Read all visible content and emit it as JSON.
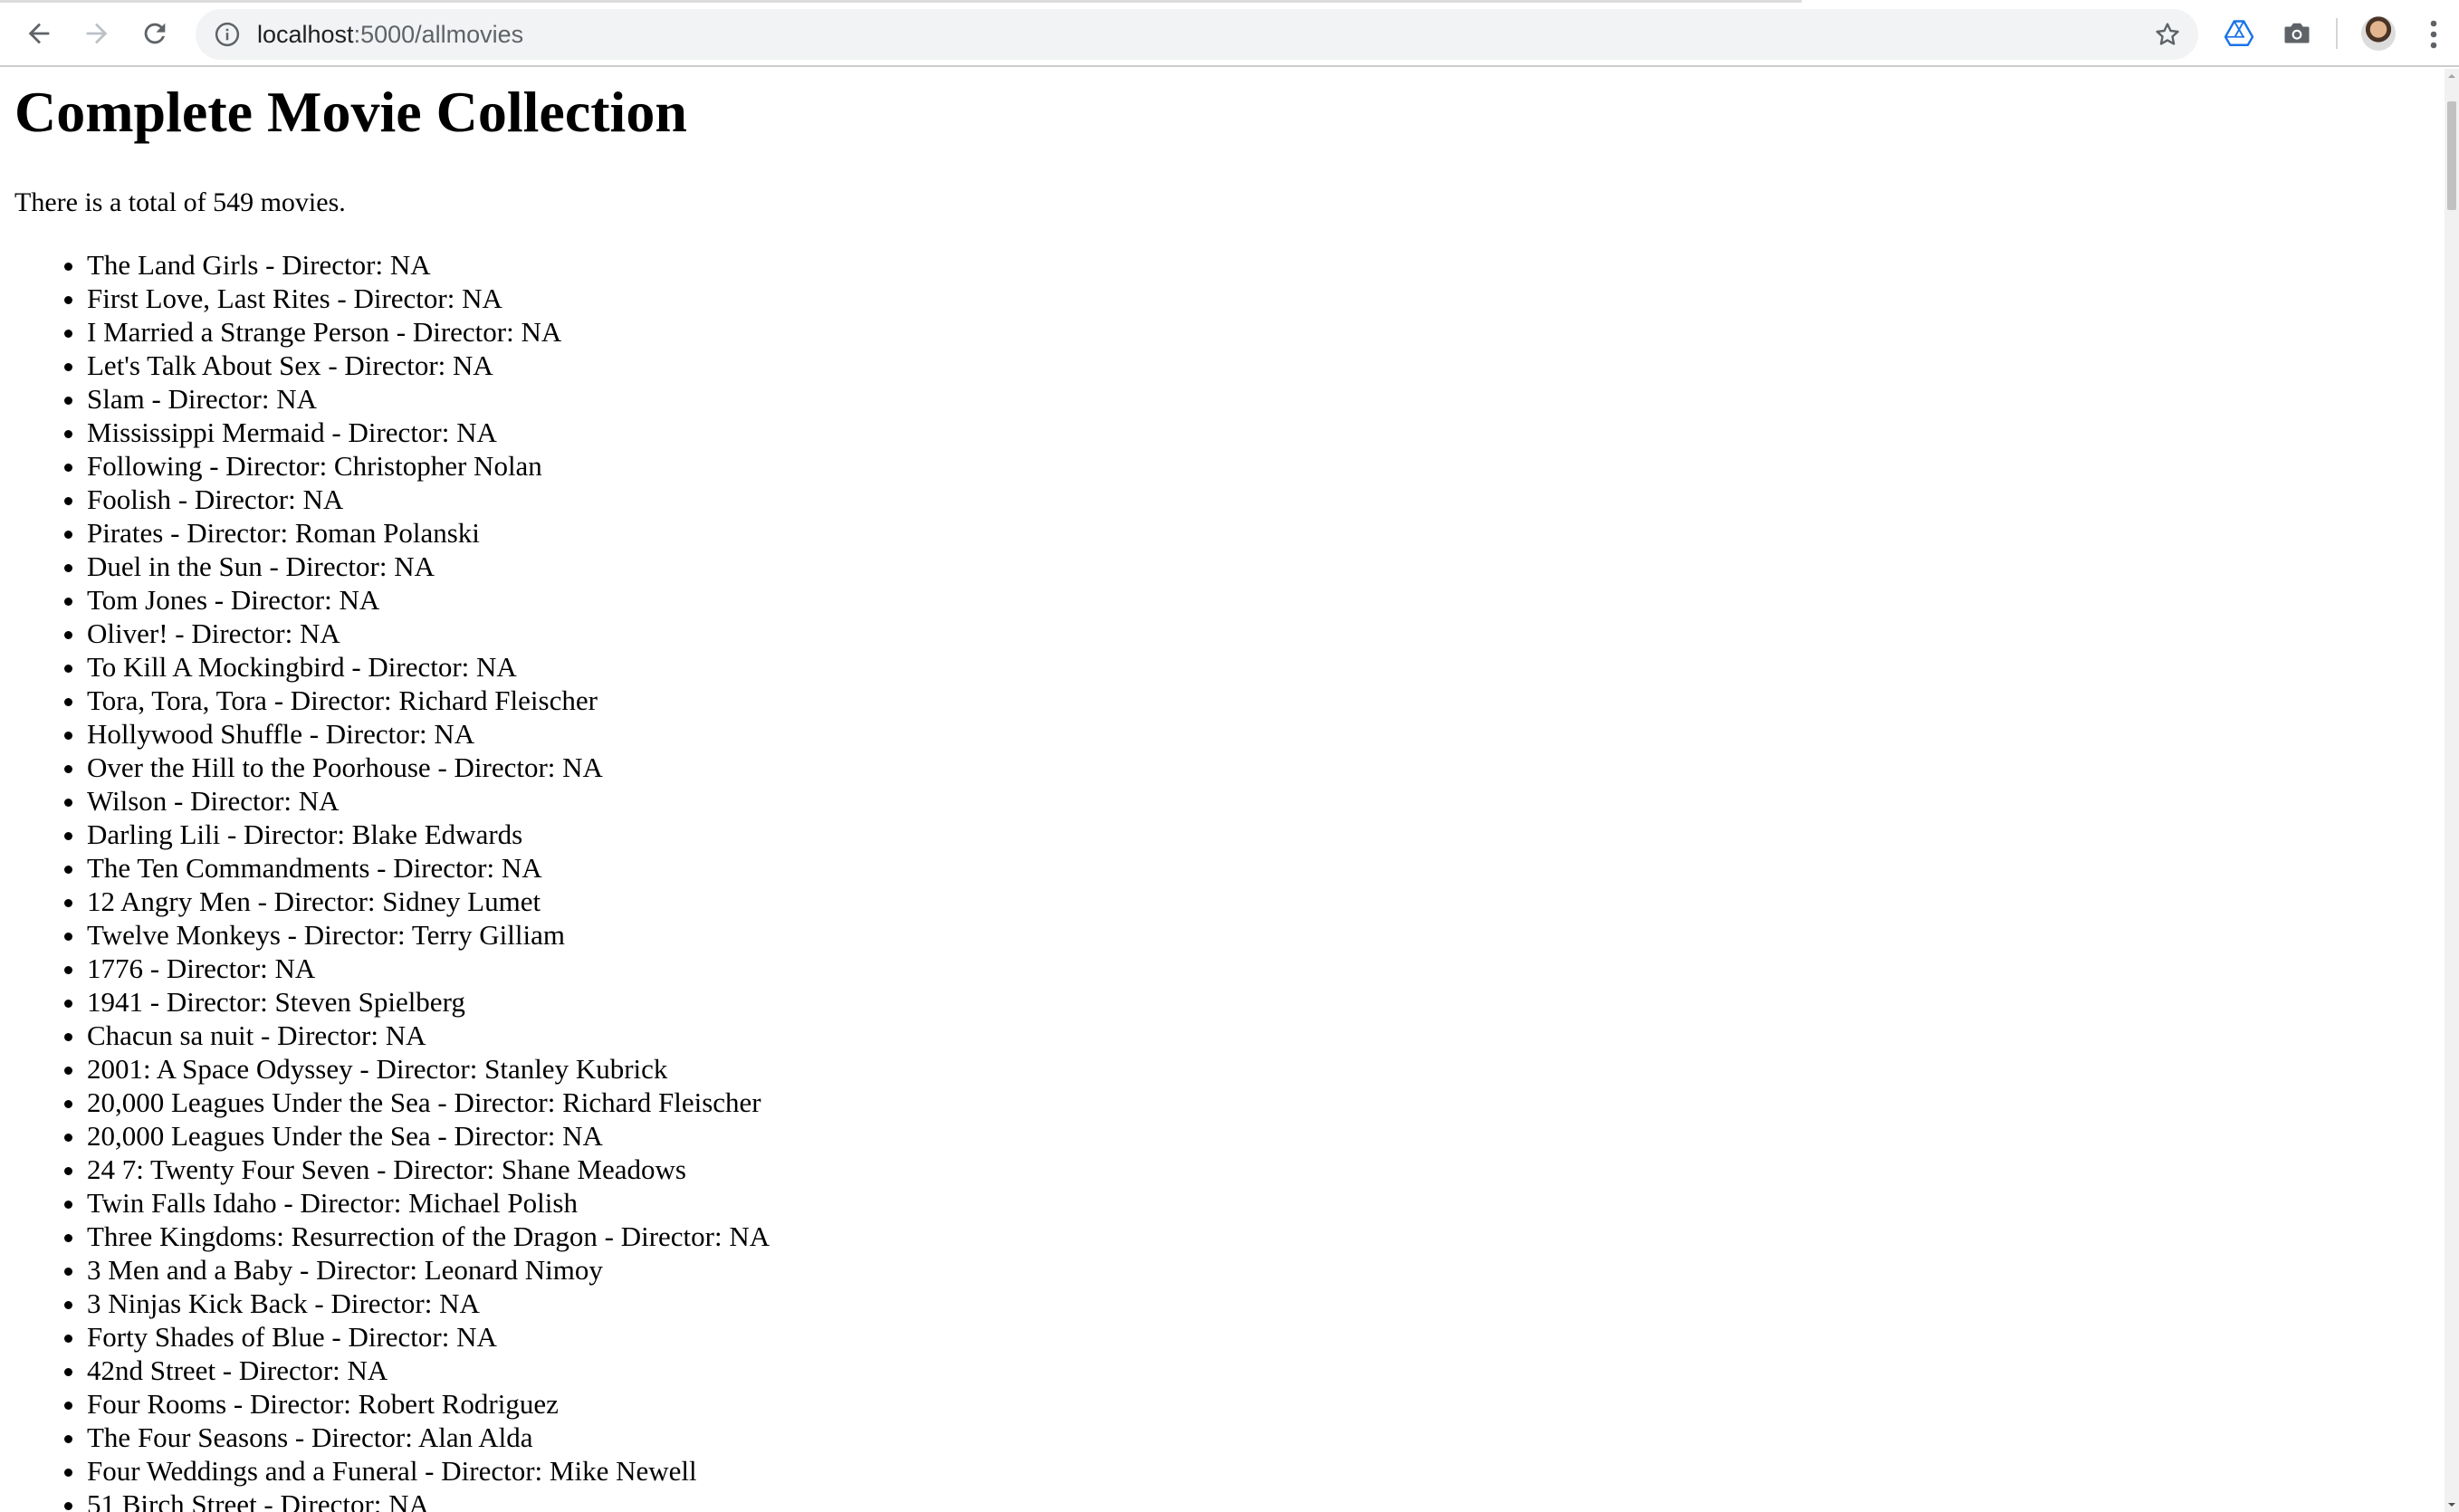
{
  "browser": {
    "url_host": "localhost",
    "url_path": ":5000/allmovies",
    "icons": {
      "back": "arrow-left-icon",
      "forward": "arrow-right-icon",
      "reload": "reload-icon",
      "site_info": "info-icon",
      "bookmark": "star-icon",
      "extension": "drive-icon",
      "screenshot": "camera-icon",
      "profile": "avatar",
      "menu": "kebab-menu-icon"
    }
  },
  "page": {
    "title": "Complete Movie Collection",
    "total_text": "There is a total of 549 movies.",
    "movies": [
      "The Land Girls - Director: NA",
      "First Love, Last Rites - Director: NA",
      "I Married a Strange Person - Director: NA",
      "Let's Talk About Sex - Director: NA",
      "Slam - Director: NA",
      "Mississippi Mermaid - Director: NA",
      "Following - Director: Christopher Nolan",
      "Foolish - Director: NA",
      "Pirates - Director: Roman Polanski",
      "Duel in the Sun - Director: NA",
      "Tom Jones - Director: NA",
      "Oliver! - Director: NA",
      "To Kill A Mockingbird - Director: NA",
      "Tora, Tora, Tora - Director: Richard Fleischer",
      "Hollywood Shuffle - Director: NA",
      "Over the Hill to the Poorhouse - Director: NA",
      "Wilson - Director: NA",
      "Darling Lili - Director: Blake Edwards",
      "The Ten Commandments - Director: NA",
      "12 Angry Men - Director: Sidney Lumet",
      "Twelve Monkeys - Director: Terry Gilliam",
      "1776 - Director: NA",
      "1941 - Director: Steven Spielberg",
      "Chacun sa nuit - Director: NA",
      "2001: A Space Odyssey - Director: Stanley Kubrick",
      "20,000 Leagues Under the Sea - Director: Richard Fleischer",
      "20,000 Leagues Under the Sea - Director: NA",
      "24 7: Twenty Four Seven - Director: Shane Meadows",
      "Twin Falls Idaho - Director: Michael Polish",
      "Three Kingdoms: Resurrection of the Dragon - Director: NA",
      "3 Men and a Baby - Director: Leonard Nimoy",
      "3 Ninjas Kick Back - Director: NA",
      "Forty Shades of Blue - Director: NA",
      "42nd Street - Director: NA",
      "Four Rooms - Director: Robert Rodriguez",
      "The Four Seasons - Director: Alan Alda",
      "Four Weddings and a Funeral - Director: Mike Newell",
      "51 Birch Street - Director: NA"
    ]
  },
  "colors": {
    "toolbar_bg": "#ffffff",
    "omnibox_bg": "#f1f3f4",
    "icon_gray": "#5f6368",
    "text": "#000000",
    "extension_blue": "#1a73e8"
  }
}
